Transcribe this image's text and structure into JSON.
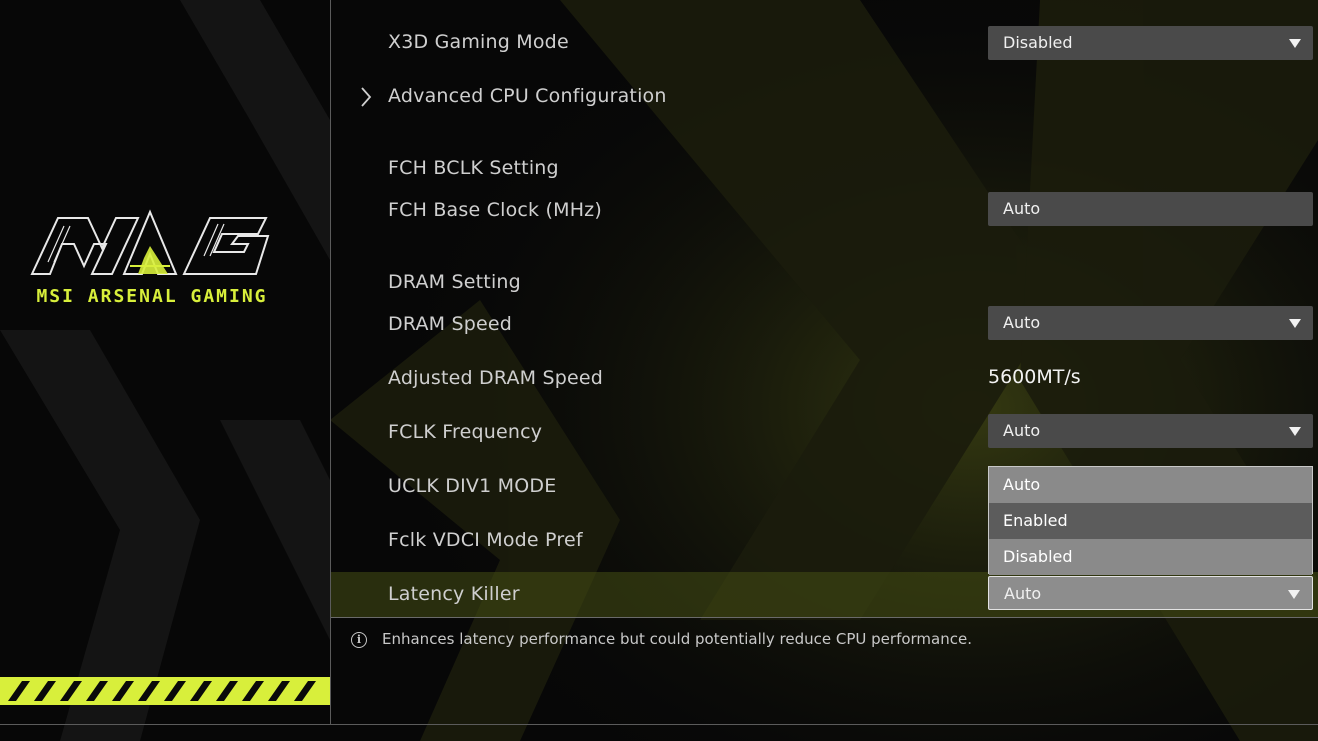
{
  "colors": {
    "accent": "#d8ef3b",
    "dropdown_bg": "#4a4a4a",
    "popup_bg": "#8a8a8a",
    "popup_selected": "#5c5c5c"
  },
  "brand": {
    "name": "MSI ARSENAL GAMING",
    "logo_icon": "mag-logo-icon"
  },
  "settings": {
    "x3d_gaming_mode": {
      "label": "X3D Gaming Mode",
      "value": "Disabled"
    },
    "advanced_cpu": {
      "label": "Advanced CPU Configuration"
    },
    "fch_bclk_section": {
      "label": "FCH BCLK Setting"
    },
    "fch_base_clock": {
      "label": "FCH Base Clock (MHz)",
      "value": "Auto"
    },
    "dram_section": {
      "label": "DRAM Setting"
    },
    "dram_speed": {
      "label": "DRAM Speed",
      "value": "Auto"
    },
    "adjusted_dram_speed": {
      "label": "Adjusted DRAM Speed",
      "value": "5600MT/s"
    },
    "fclk_frequency": {
      "label": "FCLK Frequency",
      "value": "Auto"
    },
    "uclk_div1_mode": {
      "label": "UCLK DIV1 MODE"
    },
    "fclk_vdci_mode_pref": {
      "label": "Fclk VDCI Mode Pref"
    },
    "latency_killer": {
      "label": "Latency Killer",
      "value": "Auto"
    }
  },
  "dropdown_popup": {
    "options": [
      "Auto",
      "Enabled",
      "Disabled"
    ],
    "highlighted": "Enabled"
  },
  "help": {
    "text": "Enhances latency performance but could potentially reduce CPU performance."
  }
}
